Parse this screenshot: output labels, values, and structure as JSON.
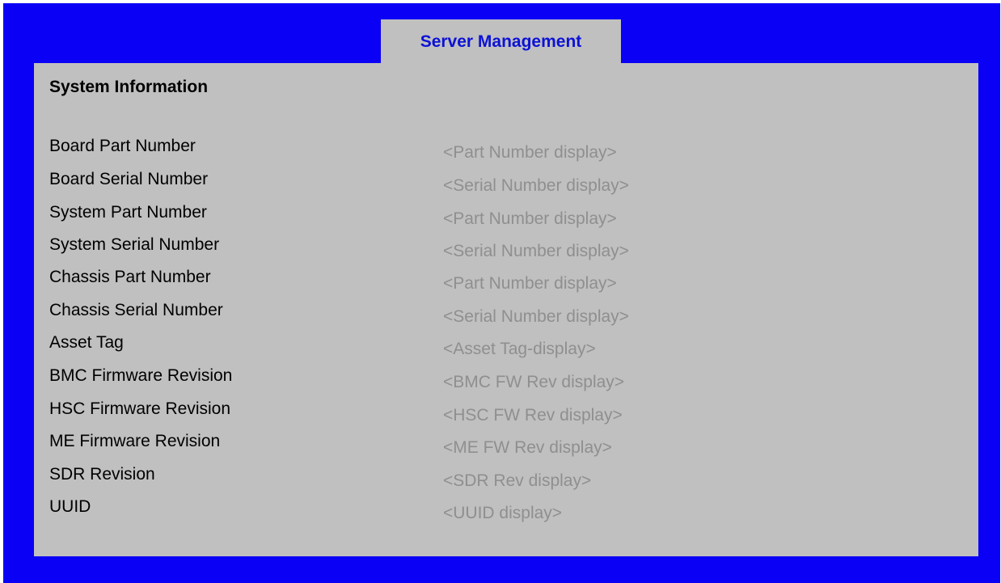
{
  "tab": {
    "label": "Server Management"
  },
  "section": {
    "title": "System Information"
  },
  "rows": [
    {
      "label": "Board Part Number",
      "value": "<Part Number display>"
    },
    {
      "label": "Board Serial Number",
      "value": "<Serial Number display>"
    },
    {
      "label": "System Part Number",
      "value": "<Part Number display>"
    },
    {
      "label": "System Serial Number",
      "value": "<Serial Number display>"
    },
    {
      "label": "Chassis Part Number",
      "value": "<Part Number display>"
    },
    {
      "label": "Chassis Serial Number",
      "value": "<Serial Number display>"
    },
    {
      "label": "Asset Tag",
      "value": "<Asset Tag-display>"
    },
    {
      "label": "BMC Firmware Revision",
      "value": "<BMC FW Rev display>"
    },
    {
      "label": "HSC Firmware Revision",
      "value": "<HSC FW Rev display>"
    },
    {
      "label": "ME Firmware Revision",
      "value": "<ME FW Rev display>"
    },
    {
      "label": "SDR Revision",
      "value": "<SDR Rev display>"
    },
    {
      "label": "UUID",
      "value": "<UUID display>"
    }
  ],
  "colors": {
    "background": "#0a00f5",
    "panel": "#c0c0c0",
    "tab_text": "#0c12d6",
    "label_text": "#000000",
    "value_text": "#8f8f8f"
  }
}
